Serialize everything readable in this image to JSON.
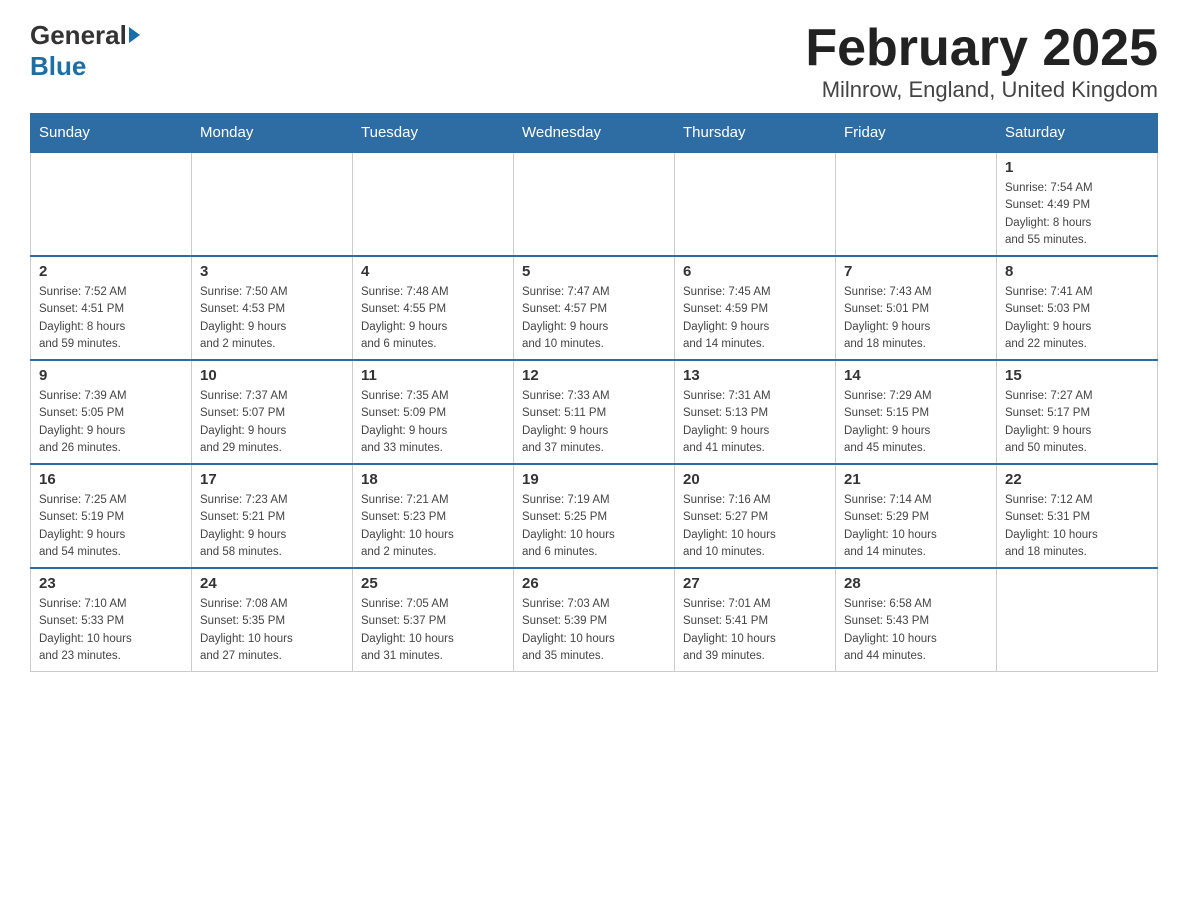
{
  "header": {
    "logo_general": "General",
    "logo_blue": "Blue",
    "title": "February 2025",
    "subtitle": "Milnrow, England, United Kingdom"
  },
  "calendar": {
    "days_of_week": [
      "Sunday",
      "Monday",
      "Tuesday",
      "Wednesday",
      "Thursday",
      "Friday",
      "Saturday"
    ],
    "weeks": [
      {
        "days": [
          {
            "number": "",
            "info": ""
          },
          {
            "number": "",
            "info": ""
          },
          {
            "number": "",
            "info": ""
          },
          {
            "number": "",
            "info": ""
          },
          {
            "number": "",
            "info": ""
          },
          {
            "number": "",
            "info": ""
          },
          {
            "number": "1",
            "info": "Sunrise: 7:54 AM\nSunset: 4:49 PM\nDaylight: 8 hours\nand 55 minutes."
          }
        ]
      },
      {
        "days": [
          {
            "number": "2",
            "info": "Sunrise: 7:52 AM\nSunset: 4:51 PM\nDaylight: 8 hours\nand 59 minutes."
          },
          {
            "number": "3",
            "info": "Sunrise: 7:50 AM\nSunset: 4:53 PM\nDaylight: 9 hours\nand 2 minutes."
          },
          {
            "number": "4",
            "info": "Sunrise: 7:48 AM\nSunset: 4:55 PM\nDaylight: 9 hours\nand 6 minutes."
          },
          {
            "number": "5",
            "info": "Sunrise: 7:47 AM\nSunset: 4:57 PM\nDaylight: 9 hours\nand 10 minutes."
          },
          {
            "number": "6",
            "info": "Sunrise: 7:45 AM\nSunset: 4:59 PM\nDaylight: 9 hours\nand 14 minutes."
          },
          {
            "number": "7",
            "info": "Sunrise: 7:43 AM\nSunset: 5:01 PM\nDaylight: 9 hours\nand 18 minutes."
          },
          {
            "number": "8",
            "info": "Sunrise: 7:41 AM\nSunset: 5:03 PM\nDaylight: 9 hours\nand 22 minutes."
          }
        ]
      },
      {
        "days": [
          {
            "number": "9",
            "info": "Sunrise: 7:39 AM\nSunset: 5:05 PM\nDaylight: 9 hours\nand 26 minutes."
          },
          {
            "number": "10",
            "info": "Sunrise: 7:37 AM\nSunset: 5:07 PM\nDaylight: 9 hours\nand 29 minutes."
          },
          {
            "number": "11",
            "info": "Sunrise: 7:35 AM\nSunset: 5:09 PM\nDaylight: 9 hours\nand 33 minutes."
          },
          {
            "number": "12",
            "info": "Sunrise: 7:33 AM\nSunset: 5:11 PM\nDaylight: 9 hours\nand 37 minutes."
          },
          {
            "number": "13",
            "info": "Sunrise: 7:31 AM\nSunset: 5:13 PM\nDaylight: 9 hours\nand 41 minutes."
          },
          {
            "number": "14",
            "info": "Sunrise: 7:29 AM\nSunset: 5:15 PM\nDaylight: 9 hours\nand 45 minutes."
          },
          {
            "number": "15",
            "info": "Sunrise: 7:27 AM\nSunset: 5:17 PM\nDaylight: 9 hours\nand 50 minutes."
          }
        ]
      },
      {
        "days": [
          {
            "number": "16",
            "info": "Sunrise: 7:25 AM\nSunset: 5:19 PM\nDaylight: 9 hours\nand 54 minutes."
          },
          {
            "number": "17",
            "info": "Sunrise: 7:23 AM\nSunset: 5:21 PM\nDaylight: 9 hours\nand 58 minutes."
          },
          {
            "number": "18",
            "info": "Sunrise: 7:21 AM\nSunset: 5:23 PM\nDaylight: 10 hours\nand 2 minutes."
          },
          {
            "number": "19",
            "info": "Sunrise: 7:19 AM\nSunset: 5:25 PM\nDaylight: 10 hours\nand 6 minutes."
          },
          {
            "number": "20",
            "info": "Sunrise: 7:16 AM\nSunset: 5:27 PM\nDaylight: 10 hours\nand 10 minutes."
          },
          {
            "number": "21",
            "info": "Sunrise: 7:14 AM\nSunset: 5:29 PM\nDaylight: 10 hours\nand 14 minutes."
          },
          {
            "number": "22",
            "info": "Sunrise: 7:12 AM\nSunset: 5:31 PM\nDaylight: 10 hours\nand 18 minutes."
          }
        ]
      },
      {
        "days": [
          {
            "number": "23",
            "info": "Sunrise: 7:10 AM\nSunset: 5:33 PM\nDaylight: 10 hours\nand 23 minutes."
          },
          {
            "number": "24",
            "info": "Sunrise: 7:08 AM\nSunset: 5:35 PM\nDaylight: 10 hours\nand 27 minutes."
          },
          {
            "number": "25",
            "info": "Sunrise: 7:05 AM\nSunset: 5:37 PM\nDaylight: 10 hours\nand 31 minutes."
          },
          {
            "number": "26",
            "info": "Sunrise: 7:03 AM\nSunset: 5:39 PM\nDaylight: 10 hours\nand 35 minutes."
          },
          {
            "number": "27",
            "info": "Sunrise: 7:01 AM\nSunset: 5:41 PM\nDaylight: 10 hours\nand 39 minutes."
          },
          {
            "number": "28",
            "info": "Sunrise: 6:58 AM\nSunset: 5:43 PM\nDaylight: 10 hours\nand 44 minutes."
          },
          {
            "number": "",
            "info": ""
          }
        ]
      }
    ]
  }
}
